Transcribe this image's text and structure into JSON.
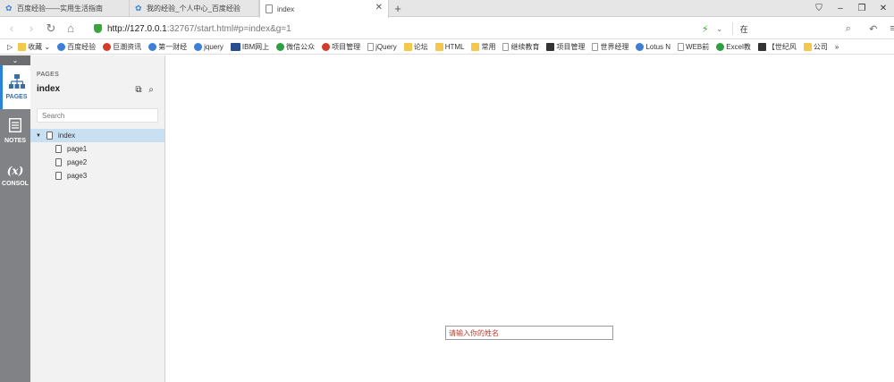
{
  "browser": {
    "tabs": [
      {
        "label": "百度经验——实用生活指南"
      },
      {
        "label": "我的经验_个人中心_百度经验"
      },
      {
        "label": "index"
      }
    ],
    "url": {
      "host": "http://127.0.0.1",
      "rest": ":32767/start.html#p=index&g=1"
    },
    "search_value": "在",
    "bookmarks": [
      {
        "label": "收藏",
        "icon": "star-folder"
      },
      {
        "label": "百度经验",
        "icon": "blue"
      },
      {
        "label": "巨潮资讯",
        "icon": "red"
      },
      {
        "label": "第一财经",
        "icon": "blue"
      },
      {
        "label": "jquery",
        "icon": "blue"
      },
      {
        "label": "IBM网上",
        "icon": "ibm"
      },
      {
        "label": "微信公众",
        "icon": "green"
      },
      {
        "label": "项目管理",
        "icon": "red"
      },
      {
        "label": "jQuery",
        "icon": "doc"
      },
      {
        "label": "论坛",
        "icon": "folder"
      },
      {
        "label": "HTML",
        "icon": "folder"
      },
      {
        "label": "常用",
        "icon": "folder"
      },
      {
        "label": "继续教育",
        "icon": "doc"
      },
      {
        "label": "项目管理",
        "icon": "dark"
      },
      {
        "label": "世界经理",
        "icon": "doc"
      },
      {
        "label": "Lotus N",
        "icon": "blue"
      },
      {
        "label": "WEB前",
        "icon": "doc"
      },
      {
        "label": "Excel教",
        "icon": "green"
      },
      {
        "label": "【世纪风",
        "icon": "dark"
      },
      {
        "label": "公司",
        "icon": "folder"
      }
    ],
    "more": "»"
  },
  "rail": {
    "pages": "PAGES",
    "notes": "NOTES",
    "console": "CONSOL",
    "console_glyph": "(x)"
  },
  "panel": {
    "title": "PAGES",
    "current": "index",
    "search_placeholder": "Search",
    "tree": [
      {
        "label": "index",
        "selected": true
      },
      {
        "label": "page1"
      },
      {
        "label": "page2"
      },
      {
        "label": "page3"
      }
    ]
  },
  "canvas": {
    "name_placeholder": "请输入你的姓名"
  },
  "colors": {
    "rail_bg": "#808285",
    "active_accent": "#2b82d9",
    "selection": "#c9e0f3",
    "input_text": "#c0392b"
  }
}
